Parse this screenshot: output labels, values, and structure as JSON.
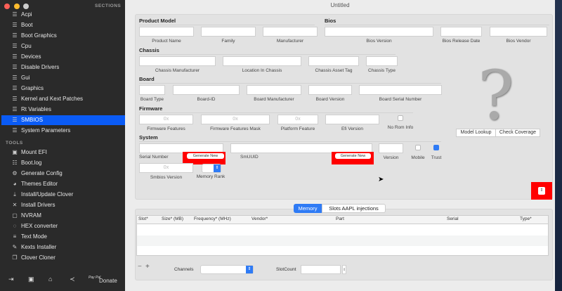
{
  "window": {
    "title": "Untitled"
  },
  "sidebar": {
    "sections_header": "SECTIONS",
    "sections": [
      {
        "label": "Acpi"
      },
      {
        "label": "Boot"
      },
      {
        "label": "Boot Graphics"
      },
      {
        "label": "Cpu"
      },
      {
        "label": "Devices"
      },
      {
        "label": "Disable Drivers"
      },
      {
        "label": "Gui"
      },
      {
        "label": "Graphics"
      },
      {
        "label": "Kernel and Kext Patches"
      },
      {
        "label": "Rt Variables"
      },
      {
        "label": "SMBIOS",
        "selected": true
      },
      {
        "label": "System Parameters"
      }
    ],
    "tools_header": "TOOLS",
    "tools": [
      {
        "label": "Mount EFI",
        "icon": "disk-icon"
      },
      {
        "label": "Boot.log",
        "icon": "log-icon"
      },
      {
        "label": "Generate Config",
        "icon": "gears-icon"
      },
      {
        "label": "Themes Editor",
        "icon": "palette-icon"
      },
      {
        "label": "Install/Update Clover",
        "icon": "download-icon"
      },
      {
        "label": "Install Drivers",
        "icon": "tools-icon"
      },
      {
        "label": "NVRAM",
        "icon": "chip-icon"
      },
      {
        "label": "HEX converter",
        "icon": "refresh-icon"
      },
      {
        "label": "Text Mode",
        "icon": "text-icon"
      },
      {
        "label": "Kexts Installer",
        "icon": "kext-icon"
      },
      {
        "label": "Clover Cloner",
        "icon": "clone-icon"
      }
    ],
    "bottom": {
      "donate": "Donate",
      "paypal": "Pay Pal"
    }
  },
  "smbios": {
    "product_model": {
      "heading": "Product Model",
      "product_name": "Product Name",
      "family": "Family",
      "manufacturer": "Manufacturer"
    },
    "bios": {
      "heading": "Bios",
      "version": "Bios Version",
      "release_date": "Bios Release Date",
      "vendor": "Bios Vendor"
    },
    "chassis": {
      "heading": "Chassis",
      "manufacturer": "Chassis Manufacturer",
      "location": "Location In Chassis",
      "asset_tag": "Chassis  Asset Tag",
      "type": "Chassis Type"
    },
    "board": {
      "heading": "Board",
      "type": "Board Type",
      "id": "Board-ID",
      "manufacturer": "Board Manufacturer",
      "version": "Board Version",
      "serial": "Board Serial Number"
    },
    "firmware": {
      "heading": "Firmware",
      "features": "Firmware Features",
      "features_mask": "Firmware Features Mask",
      "platform_feature": "Platform Feature",
      "efi_version": "Efi Version",
      "no_rom_info": "No Rom Info",
      "placeholder": "0x"
    },
    "system": {
      "heading": "System",
      "serial": "Serial Number",
      "generate": "Generate New",
      "smuuid": "SmUUID",
      "version": "Version",
      "mobile": "Mobile",
      "trust": "Trust",
      "smbios_version": "Smbios Version",
      "memory_rank": "Memory Rank",
      "placeholder": "0x"
    },
    "model_lookup": "Model Lookup",
    "check_coverage": "Check Coverage"
  },
  "memory": {
    "tabs": [
      {
        "label": "Memory",
        "active": true
      },
      {
        "label": "Slots AAPL injections"
      }
    ],
    "columns": [
      "Slot*",
      "Size* (MB)",
      "Frequency* (MHz)",
      "Vendor*",
      "Part",
      "Serial",
      "Type*"
    ],
    "channels_label": "Channels",
    "slotcount_label": "SlotCount"
  },
  "colors": {
    "accent": "#0a5bf5",
    "highlight": "#ff0000"
  }
}
